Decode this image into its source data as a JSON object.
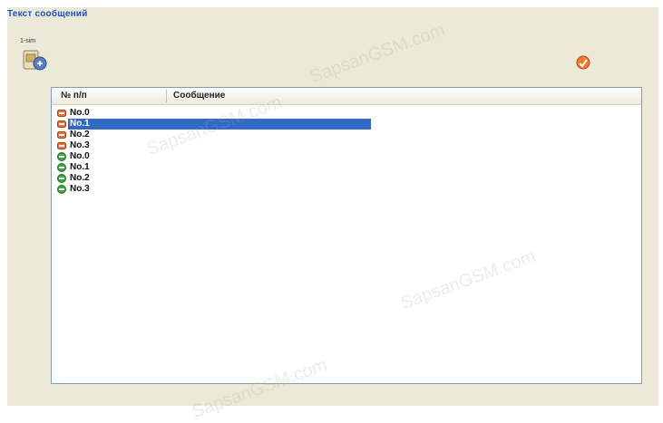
{
  "panel": {
    "title": "Текст сообщений",
    "tool_caption": "1-sim"
  },
  "table": {
    "columns": [
      "№ п/п",
      "Сообщение"
    ],
    "selected_index": 1,
    "rows": [
      {
        "label": "No.0",
        "icon": "sim-message-icon"
      },
      {
        "label": "No.1",
        "icon": "sim-message-icon"
      },
      {
        "label": "No.2",
        "icon": "sim-message-icon"
      },
      {
        "label": "No.3",
        "icon": "sim-message-icon"
      },
      {
        "label": "No.0",
        "icon": "phone-message-icon"
      },
      {
        "label": "No.1",
        "icon": "phone-message-icon"
      },
      {
        "label": "No.2",
        "icon": "phone-message-icon"
      },
      {
        "label": "No.3",
        "icon": "phone-message-icon"
      }
    ]
  },
  "colors": {
    "selection": "#316ac5",
    "title": "#1e50c8",
    "sim_icon": "#e8733a",
    "phone_icon": "#43a343"
  },
  "watermark": {
    "text": "SapsanGSM.com"
  }
}
